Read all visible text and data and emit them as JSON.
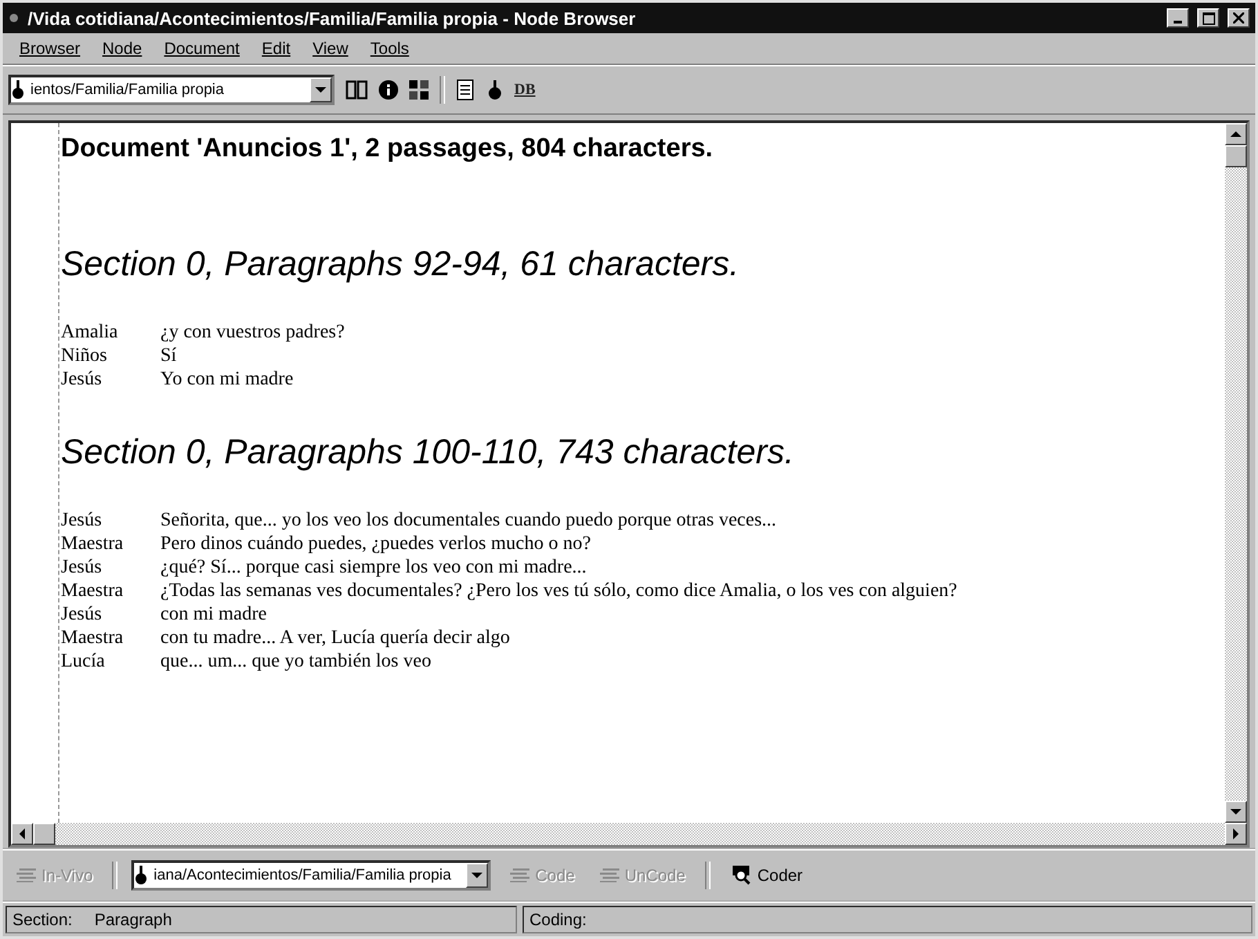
{
  "window": {
    "title": "/Vida cotidiana/Acontecimientos/Familia/Familia propia - Node Browser"
  },
  "menu": [
    "Browser",
    "Node",
    "Document",
    "Edit",
    "View",
    "Tools"
  ],
  "toolbar": {
    "node_path": "ientos/Familia/Familia propia",
    "db_label": "DB"
  },
  "document": {
    "title": "Document 'Anuncios 1',  2 passages, 804 characters.",
    "sections": [
      {
        "heading": "Section 0, Paragraphs 92-94, 61 characters.",
        "lines": [
          {
            "speaker": "Amalia",
            "text": "¿y con vuestros padres?"
          },
          {
            "speaker": "Niños",
            "text": "Sí"
          },
          {
            "speaker": "Jesús",
            "text": "Yo con mi madre"
          }
        ]
      },
      {
        "heading": "Section 0, Paragraphs 100-110, 743 characters.",
        "lines": [
          {
            "speaker": "Jesús",
            "text": "Señorita, que... yo los veo los documentales cuando puedo porque otras veces..."
          },
          {
            "speaker": "Maestra",
            "text": "Pero dinos cuándo puedes, ¿puedes verlos mucho o no?"
          },
          {
            "speaker": "Jesús",
            "text": "¿qué? Sí... porque casi siempre los veo con mi madre..."
          },
          {
            "speaker": "Maestra",
            "text": "¿Todas las semanas ves documentales? ¿Pero los ves tú sólo, como dice Amalia, o los ves con alguien?"
          },
          {
            "speaker": "Jesús",
            "text": "con mi madre"
          },
          {
            "speaker": "Maestra",
            "text": "con tu madre... A ver, Lucía quería decir algo"
          },
          {
            "speaker": "Lucía",
            "text": "que... um... que yo también los veo"
          }
        ]
      }
    ]
  },
  "coding_bar": {
    "node_path": "iana/Acontecimientos/Familia/Familia propia",
    "buttons": [
      {
        "kind": "invivo",
        "label": "In-Vivo",
        "disabled": true
      },
      {
        "kind": "code",
        "label": "Code",
        "disabled": true
      },
      {
        "kind": "uncode",
        "label": "UnCode",
        "disabled": true
      },
      {
        "kind": "coder",
        "label": "Coder",
        "disabled": false
      }
    ]
  },
  "status_bar": {
    "section_label": "Section:",
    "section_value": "Paragraph",
    "coding_label": "Coding:"
  }
}
